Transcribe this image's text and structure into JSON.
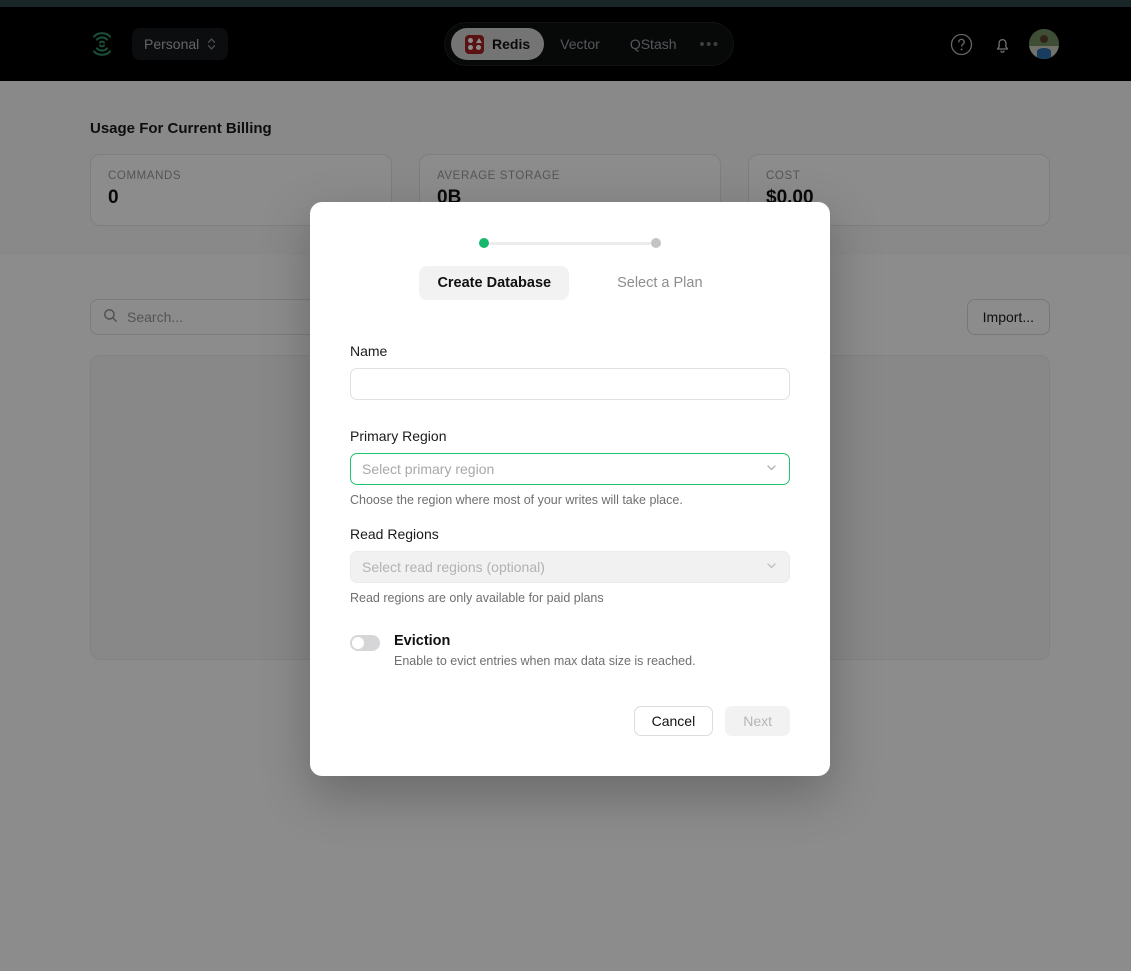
{
  "topbar": {
    "logo_icon": "upstash-logo-icon",
    "org_switcher": {
      "label": "Personal",
      "icon": "chevron-updown-icon"
    },
    "nav": [
      {
        "label": "Redis",
        "icon": "redis-logo-icon",
        "active": true
      },
      {
        "label": "Vector",
        "icon": "",
        "active": false
      },
      {
        "label": "QStash",
        "icon": "",
        "active": false
      }
    ],
    "more_label": "•••",
    "help_icon": "help-circle-icon",
    "notifications_icon": "bell-icon",
    "avatar_icon": "user-avatar"
  },
  "usage": {
    "title": "Usage For Current Billing",
    "cards": [
      {
        "label": "COMMANDS",
        "value": "0"
      },
      {
        "label": "AVERAGE STORAGE",
        "value": "0B"
      },
      {
        "label": "COST",
        "value": "$0.00"
      }
    ]
  },
  "toolbar": {
    "search_placeholder": "Search...",
    "search_value": "",
    "search_icon": "search-icon",
    "import_label": "Import..."
  },
  "modal": {
    "steps": [
      {
        "label": "Create Database",
        "active": true,
        "state": "done"
      },
      {
        "label": "Select a Plan",
        "active": false,
        "state": "todo"
      }
    ],
    "name": {
      "label": "Name",
      "value": "",
      "placeholder": ""
    },
    "primary_region": {
      "label": "Primary Region",
      "value": "Select primary region",
      "hint": "Choose the region where most of your writes will take place.",
      "chevron_icon": "chevron-down-icon",
      "focused": true
    },
    "read_regions": {
      "label": "Read Regions",
      "value": "Select read regions (optional)",
      "hint": "Read regions are only available for paid plans",
      "chevron_icon": "chevron-down-icon",
      "disabled": true
    },
    "eviction": {
      "title": "Eviction",
      "description": "Enable to evict entries when max data size is reached.",
      "enabled": false
    },
    "actions": {
      "cancel_label": "Cancel",
      "next_label": "Next"
    }
  },
  "colors": {
    "accent_green": "#15b86b",
    "focus_green": "#20c46f",
    "redis_red": "#a32020",
    "topbar_bg": "#000000",
    "top_strip": "#2c4549"
  }
}
